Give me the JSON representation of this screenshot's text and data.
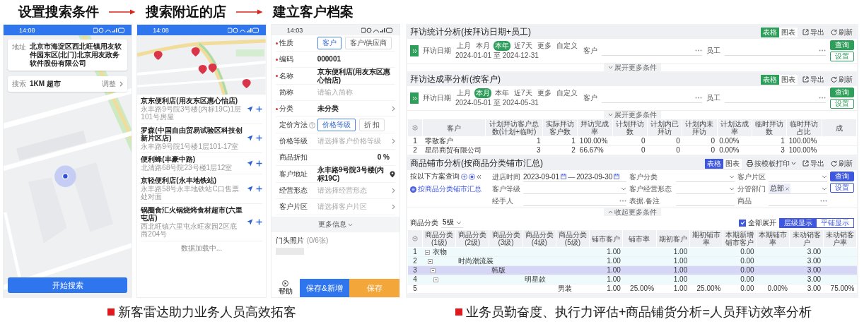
{
  "steps": [
    {
      "label": "设置搜索条件"
    },
    {
      "label": "搜索附近的店"
    },
    {
      "label": "建立客户档案"
    }
  ],
  "search_phone": {
    "status_time": "14:08",
    "address_label": "地址",
    "address": "北京市海淀区西北旺镇用友软件园东区(北门)北京用友政务软件股份有限公司",
    "search_label": "搜索",
    "search_value": "1KM 超市",
    "adjust": "调整",
    "start_button": "开始搜索"
  },
  "nearby_phone": {
    "status_time": "14:08",
    "stores": [
      {
        "name": "京东便利店(用友东区惠心怡店)",
        "address": "永丰路9号院3号楼(内标19C)1层101号房屋"
      },
      {
        "name": "罗森(中国自由贸易试验区科技创新片区店)",
        "address": "永丰路9号院1号楼1层101-17室"
      },
      {
        "name": "便利蜂(丰豪中路)",
        "address": "北清路68号院23号楼1层12室"
      },
      {
        "name": "京轻便利店(永丰地铁站)",
        "address": "永丰路58号永丰地铁站C口售票处对面"
      },
      {
        "name": "锅圈食汇火锅烧烤食材超市(六里屯店)",
        "address": "西北旺镇六里屯永旺家园2区底商204号"
      }
    ],
    "loading": "数据加载中..."
  },
  "customer_form_phone": {
    "status_time": "14:03",
    "fields": [
      {
        "label": "性质",
        "required": true,
        "kind": "choice",
        "options": [
          {
            "label": "客户",
            "selected": true
          },
          {
            "label": "客户/供应商",
            "selected": false
          }
        ]
      },
      {
        "label": "编码",
        "required": true,
        "kind": "text",
        "value": "000001"
      },
      {
        "label": "名称",
        "required": true,
        "kind": "text",
        "value": "京东便利店(用友东区惠心怡店)"
      },
      {
        "label": "简称",
        "required": false,
        "kind": "text",
        "placeholder": "请输入简称"
      },
      {
        "label": "分类",
        "required": true,
        "kind": "select",
        "value": "未分类"
      },
      {
        "label": "定价方法",
        "required": false,
        "help": true,
        "kind": "choice",
        "options": [
          {
            "label": "价格等级",
            "selected": true
          },
          {
            "label": "折 扣",
            "selected": false
          }
        ]
      },
      {
        "label": "价格等级",
        "required": false,
        "kind": "select",
        "placeholder": "请选择客户价格等级"
      },
      {
        "label": "商品折扣",
        "required": false,
        "kind": "number",
        "value": "0 %"
      },
      {
        "label": "客户地址",
        "required": false,
        "kind": "address",
        "value": "永丰路9号院3号楼(内标19C)"
      },
      {
        "label": "经营形态",
        "required": false,
        "kind": "select",
        "placeholder": "请选择经营形态"
      },
      {
        "label": "客户片区",
        "required": false,
        "kind": "select",
        "placeholder": "请选择客户片区"
      }
    ],
    "more": "更多信息",
    "photo_label": "门头照片",
    "photo_count": "(0/6张)",
    "help": "帮助",
    "save_new": "保存&新增",
    "save": "保存"
  },
  "visit_stats": {
    "title": "拜访统计分析(按拜访日期+员工)",
    "view_tabs": [
      {
        "label": "表格",
        "selected": true
      },
      {
        "label": "图表",
        "selected": false
      }
    ],
    "actions": [
      {
        "kind": "export",
        "label": "导出"
      },
      {
        "kind": "refresh",
        "label": "刷新"
      }
    ],
    "date_label": "拜访日期",
    "periods": [
      {
        "label": "上月",
        "selected": false
      },
      {
        "label": "本月",
        "selected": false
      },
      {
        "label": "本年",
        "selected": true
      },
      {
        "label": "近7天",
        "selected": false
      },
      {
        "label": "更多",
        "selected": false
      },
      {
        "label": "自定义",
        "selected": false
      }
    ],
    "date_range": "2024-01-01 至 2024-12-31",
    "filters": [
      {
        "label": "客户"
      },
      {
        "label": "员工"
      }
    ],
    "query": "查询",
    "settings": "设置",
    "expand": "展开更多条件"
  },
  "visit_rate": {
    "title": "拜访达成率分析(按客户)",
    "view_tabs": [
      {
        "label": "表格",
        "selected": true
      },
      {
        "label": "图表",
        "selected": false
      }
    ],
    "actions": [
      {
        "kind": "export",
        "label": "导出"
      },
      {
        "kind": "refresh",
        "label": "刷新"
      }
    ],
    "date_label": "拜访日期",
    "periods": [
      {
        "label": "上月",
        "selected": false
      },
      {
        "label": "本月",
        "selected": true
      },
      {
        "label": "本年",
        "selected": false
      },
      {
        "label": "近7天",
        "selected": false
      },
      {
        "label": "更多",
        "selected": false
      },
      {
        "label": "自定义",
        "selected": false
      }
    ],
    "date_range": "2024-05-01 至 2024-05-31",
    "filters": [
      {
        "label": "客户"
      },
      {
        "label": "员工"
      }
    ],
    "query": "查询",
    "settings": "设置",
    "expand": "展开更多条件",
    "table": {
      "columns": [
        "客户",
        "计划拜访客户总数(计划+临时)",
        "实际拜访客户数",
        "拜访完成率",
        "计划拜访数",
        "计划内已拜访",
        "计划内未拜访",
        "计划达成率",
        "临时拜访数",
        "临时拜访占比",
        "成"
      ],
      "rows": [
        {
          "index": "1",
          "cells": [
            "零散客户",
            "1",
            "1",
            "100.00%",
            "0",
            "0",
            "0",
            "0.00%",
            "1",
            "100.00%"
          ]
        },
        {
          "index": "2",
          "cells": [
            "星昂商贸有限公司",
            "3",
            "2",
            "66.67%",
            "0",
            "0",
            "0",
            "0.00%",
            "3",
            "100.00%"
          ]
        }
      ]
    }
  },
  "coverage": {
    "title": "商品铺市分析(按商品分类铺市汇总)",
    "view_tabs": [
      {
        "label": "表格",
        "selected": true
      },
      {
        "label": "图表",
        "selected": false
      }
    ],
    "actions": [
      {
        "kind": "print",
        "label": "按模板打印"
      },
      {
        "kind": "export",
        "label": "导出"
      },
      {
        "kind": "refresh",
        "label": "刷新"
      }
    ],
    "scheme_label": "按以下方案查询",
    "scheme": "按商品分类铺市汇总",
    "filters": [
      {
        "label": "进店时间",
        "kind": "date_range",
        "from": "2023-09-01",
        "separator": "—",
        "to": "2023-09-30"
      },
      {
        "label": "客户分类",
        "kind": "dropdown"
      },
      {
        "label": "客户片区",
        "kind": "dropdown"
      },
      {
        "label": "客户等级",
        "kind": "dropdown"
      },
      {
        "label": "客户经营形态",
        "kind": "dropdown"
      },
      {
        "label": "分管部门",
        "kind": "tags",
        "tags": [
          "总部"
        ]
      },
      {
        "label": "经手人",
        "kind": "picker"
      },
      {
        "label": "表据.备注",
        "kind": "text"
      },
      {
        "label": "商品",
        "kind": "picker"
      }
    ],
    "query": "查询",
    "settings": "设置",
    "collapse": "收起更多条件",
    "level_label": "商品分类",
    "level_value": "5级",
    "expand_all": {
      "label": "全部展开",
      "checked": true
    },
    "display_modes": [
      {
        "label": "层级显示",
        "selected": true
      },
      {
        "label": "平铺显示",
        "selected": false
      }
    ],
    "table": {
      "columns": [
        "商品分类(1级)",
        "商品分类(2级)",
        "商品分类(3级)",
        "商品分类(4级)",
        "商品分类(5级)",
        "铺市客户",
        "铺市率",
        "期初客户",
        "期初铺市率",
        "本期新增铺市客户",
        "本期铺市率",
        "未动销客户",
        "未动销客户率"
      ],
      "rows": [
        {
          "index": "1",
          "category": "衣物",
          "values": {
            "coverage_customers": "1.00",
            "opening_customers": "1.00",
            "new_customers": "0.00",
            "unsold_customers": "3.00"
          },
          "selected": false,
          "expanded": true,
          "children": [
            {
              "index": "2",
              "category": "时尚潮流装",
              "values": {
                "coverage_customers": "1.00",
                "opening_customers": "1.00",
                "new_customers": "0.00",
                "unsold_customers": "3.00"
              },
              "selected": false,
              "expanded": true,
              "children": [
                {
                  "index": "3",
                  "category": "韩版",
                  "values": {
                    "coverage_customers": "1.00",
                    "opening_customers": "1.00",
                    "new_customers": "0.00",
                    "unsold_customers": "3.00"
                  },
                  "selected": true,
                  "expanded": true,
                  "children": [
                    {
                      "index": "4",
                      "category": "明星款",
                      "values": {
                        "coverage_customers": "1.00",
                        "opening_customers": "1.00",
                        "new_customers": "0.00",
                        "unsold_customers": "3.00"
                      },
                      "selected": false,
                      "expanded": true,
                      "children": [
                        {
                          "index": "5",
                          "category": "男装",
                          "values": {
                            "coverage_customers": "1.00",
                            "coverage_rate": "25.00%",
                            "opening_customers": "1.00",
                            "opening_rate": "25.00%",
                            "new_customers": "0.00",
                            "period_rate": "0.00%",
                            "unsold_customers": "3.00",
                            "unsold_rate": "75.00%"
                          },
                          "selected": false
                        }
                      ]
                    }
                  ]
                }
              ]
            }
          ]
        }
      ]
    }
  },
  "captions": [
    {
      "text": "新客雷达助力业务人员高效拓客"
    },
    {
      "text": "业务员勤奋度、执行力评估+商品铺货分析=人员拜访效率分析"
    }
  ]
}
